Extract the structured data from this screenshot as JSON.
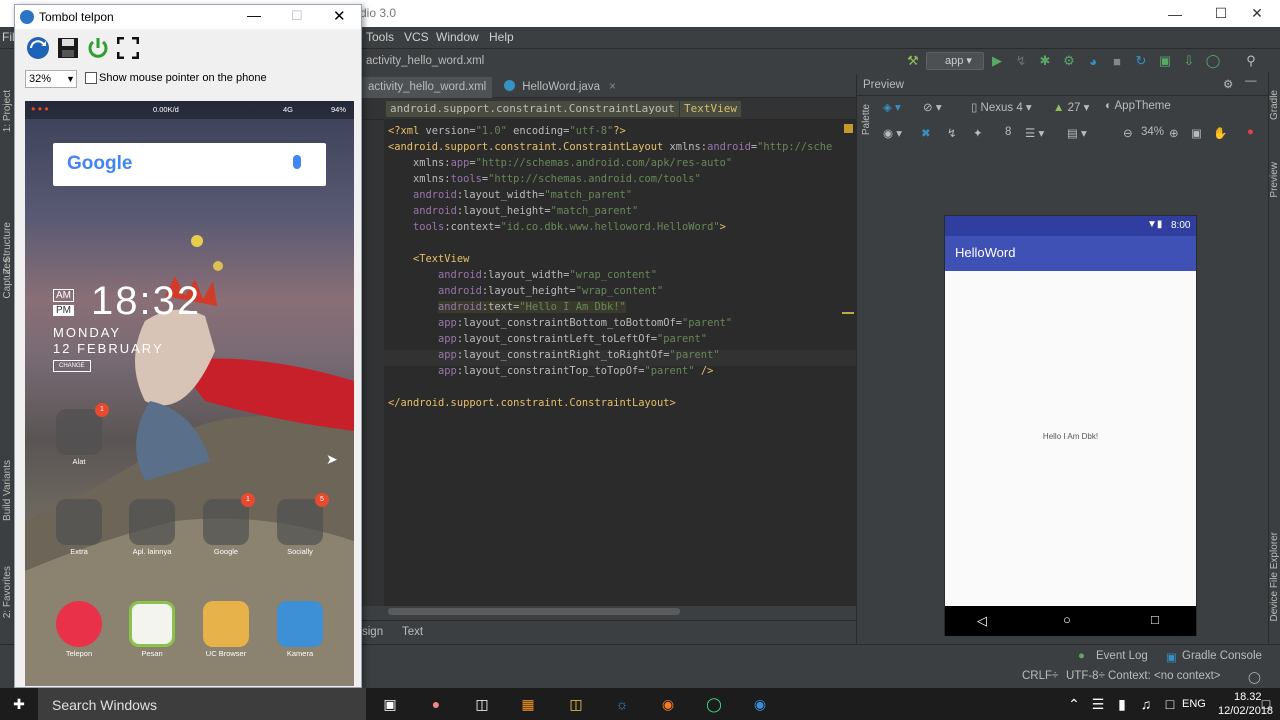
{
  "ide": {
    "title_fragment": "dio 3.0",
    "menu": [
      "Tools",
      "VCS",
      "Window",
      "Help"
    ],
    "menu_left_fragment": "Fil",
    "nav_crumb": "activity_hello_word.xml",
    "run_config": "app",
    "tabs": [
      {
        "label": "activity_hello_word.xml",
        "close": "×"
      },
      {
        "label": "HelloWord.java",
        "close": "×"
      }
    ],
    "crumbs": [
      "android.support.constraint.ConstraintLayout",
      "TextView"
    ],
    "bottom_tabs": [
      "sign",
      "Text"
    ],
    "left_tools": [
      "1: Project",
      "Z: Structure",
      "Captures",
      "Build Variants",
      "2: Favorites"
    ],
    "right_tools": [
      "Gradle",
      "Preview",
      "Device File Explorer"
    ],
    "preview": {
      "title": "Preview",
      "palette_label": "Palette",
      "device": "Nexus 4",
      "api": "27",
      "theme": "AppTheme",
      "zoom": "34%",
      "margin": "8",
      "app_name": "HelloWord",
      "time": "8:00",
      "hello_text": "Hello I Am Dbk!"
    },
    "status": {
      "event_log": "Event Log",
      "gradle_console": "Gradle Console",
      "crlf": "CRLF÷",
      "encoding": "UTF-8÷",
      "context": "Context: <no context>"
    }
  },
  "tombol": {
    "title": "Tombol telpon",
    "zoom": "32%",
    "mouse_pointer_label": "Show mouse pointer on the phone",
    "phone": {
      "status_speed": "0.00K/d",
      "status_net": "4G",
      "status_battery": "94%",
      "google": "Google",
      "ampm": [
        "AM",
        "PM"
      ],
      "time": "18:32",
      "day": "MONDAY",
      "date": "12 FEBRUARY",
      "change": "CHANGE",
      "apps_row1": [
        {
          "label": "Alat",
          "badge": "1"
        }
      ],
      "apps_row2": [
        {
          "label": "Extra",
          "badge": ""
        },
        {
          "label": "Apl. lainnya",
          "badge": ""
        },
        {
          "label": "Google",
          "badge": "1"
        },
        {
          "label": "Socially",
          "badge": "5"
        }
      ],
      "dock": [
        "Telepon",
        "Pesan",
        "UC Browser",
        "Kamera"
      ]
    }
  },
  "taskbar": {
    "search": "Search Windows",
    "lang": "ENG",
    "time": "18.32",
    "date": "12/02/2018"
  }
}
